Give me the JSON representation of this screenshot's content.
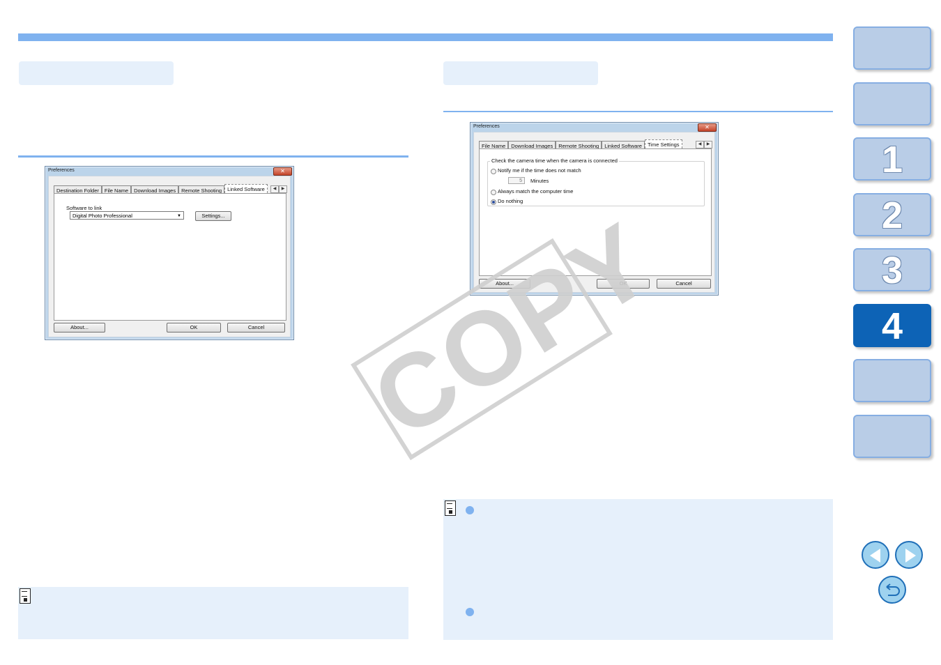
{
  "watermark": "COPY",
  "dialog_left": {
    "title": "Preferences",
    "close": "✕",
    "tabs": [
      "Destination Folder",
      "File Name",
      "Download Images",
      "Remote Shooting",
      "Linked Software"
    ],
    "active_tab": "Linked Software",
    "software_label": "Software to link",
    "software_value": "Digital Photo Professional",
    "settings_button": "Settings...",
    "about_button": "About...",
    "ok_button": "OK",
    "cancel_button": "Cancel"
  },
  "dialog_right": {
    "title": "Preferences",
    "close": "✕",
    "tabs": [
      "File Name",
      "Download Images",
      "Remote Shooting",
      "Linked Software",
      "Time Settings"
    ],
    "active_tab": "Time Settings",
    "group_label": "Check the camera time when the camera is connected",
    "option_notify": "Notify me if the time does not match",
    "minutes_value": "5",
    "minutes_label": "Minutes",
    "option_always": "Always match the computer time",
    "option_nothing": "Do nothing",
    "selected_option": "Do nothing",
    "about_button": "About...",
    "ok_button": "OK",
    "cancel_button": "Cancel"
  },
  "nav": {
    "chapters": [
      "",
      "",
      "1",
      "2",
      "3",
      "4",
      "",
      ""
    ],
    "active_chapter": "4"
  },
  "colors": {
    "accent": "#7fb2ef",
    "note_bg": "#e6f0fb",
    "active_nav": "#0d63b6",
    "nav_bg": "#b9cde7"
  },
  "icons": {
    "prev": "prev-page-icon",
    "next": "next-page-icon",
    "back": "back-icon",
    "note": "memo-icon"
  }
}
